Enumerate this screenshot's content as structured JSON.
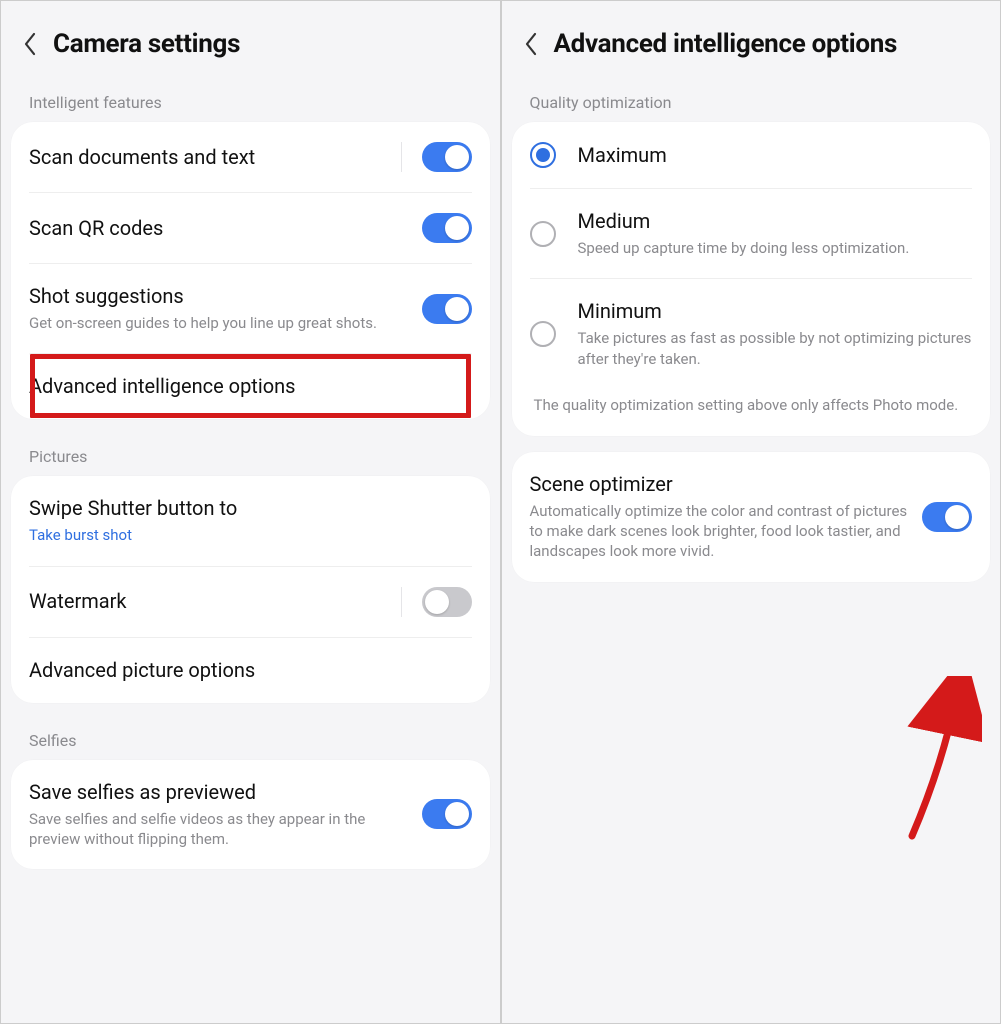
{
  "left": {
    "title": "Camera settings",
    "sections": {
      "intelligent": {
        "label": "Intelligent features",
        "rows": {
          "scan_docs": {
            "title": "Scan documents and text"
          },
          "scan_qr": {
            "title": "Scan QR codes"
          },
          "shot_sugg": {
            "title": "Shot suggestions",
            "sub": "Get on-screen guides to help you line up great shots."
          },
          "adv_intel": {
            "title": "Advanced intelligence options"
          }
        }
      },
      "pictures": {
        "label": "Pictures",
        "rows": {
          "swipe": {
            "title": "Swipe Shutter button to",
            "sub": "Take burst shot"
          },
          "watermark": {
            "title": "Watermark"
          },
          "adv_pic": {
            "title": "Advanced picture options"
          }
        }
      },
      "selfies": {
        "label": "Selfies",
        "rows": {
          "save_preview": {
            "title": "Save selfies as previewed",
            "sub": "Save selfies and selfie videos as they appear in the preview without flipping them."
          }
        }
      }
    }
  },
  "right": {
    "title": "Advanced intelligence options",
    "quality": {
      "label": "Quality optimization",
      "options": {
        "max": {
          "title": "Maximum"
        },
        "med": {
          "title": "Medium",
          "sub": "Speed up capture time by doing less optimization."
        },
        "min": {
          "title": "Minimum",
          "sub": "Take pictures as fast as possible by not optimizing pictures after they're taken."
        }
      },
      "note": "The quality optimization setting above only affects Photo mode."
    },
    "scene": {
      "title": "Scene optimizer",
      "sub": "Automatically optimize the color and contrast of pictures to make dark scenes look brighter, food look tastier, and landscapes look more vivid."
    }
  }
}
